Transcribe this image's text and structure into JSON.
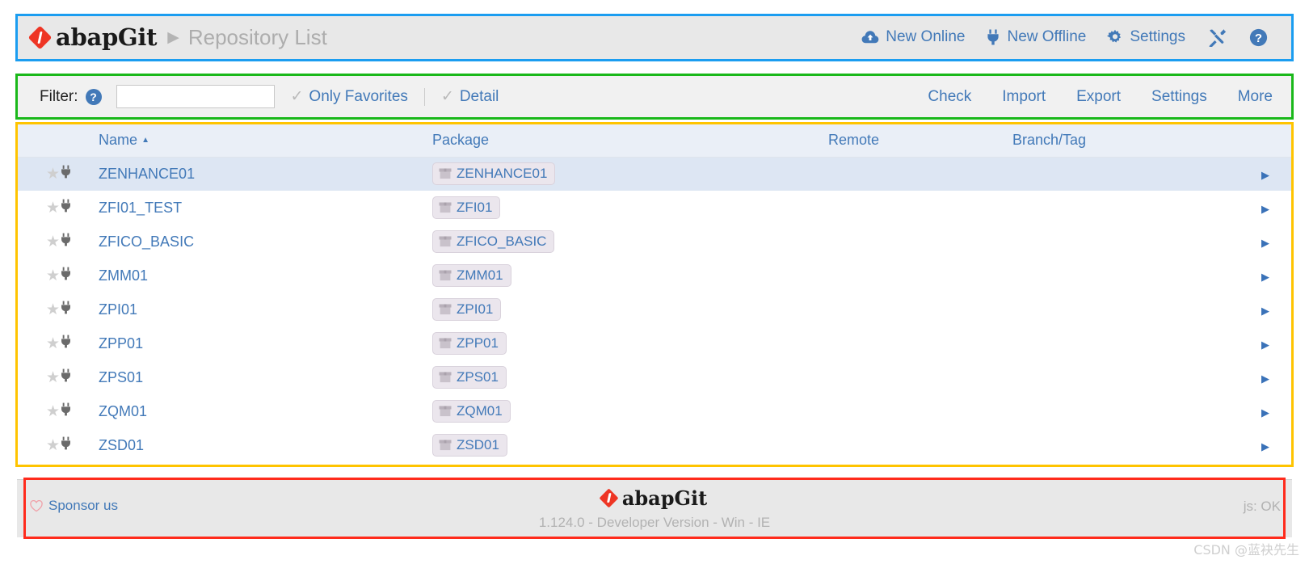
{
  "header": {
    "brand": "abapGit",
    "breadcrumb_separator": "▶",
    "title": "Repository List",
    "actions": [
      {
        "label": "New Online",
        "icon": "cloud-upload-icon"
      },
      {
        "label": "New Offline",
        "icon": "plug-icon"
      },
      {
        "label": "Settings",
        "icon": "gear-icon"
      }
    ],
    "icon_buttons": [
      {
        "name": "tools-icon"
      },
      {
        "name": "help-icon"
      }
    ]
  },
  "filter_bar": {
    "label": "Filter:",
    "help_glyph": "?",
    "input_value": "",
    "input_placeholder": "",
    "toggles": [
      {
        "label": "Only Favorites",
        "checked": false,
        "check_glyph": "✓"
      },
      {
        "label": "Detail",
        "checked": false,
        "check_glyph": "✓"
      }
    ],
    "links": [
      "Check",
      "Import",
      "Export",
      "Settings",
      "More"
    ]
  },
  "table": {
    "columns": [
      "Name",
      "Package",
      "Remote",
      "Branch/Tag"
    ],
    "sorted_column": "Name",
    "sort_caret": "▲",
    "go_caret": "▶",
    "star_glyph": "★",
    "rows": [
      {
        "name": "ZENHANCE01",
        "package": "ZENHANCE01",
        "remote": "",
        "branch": "",
        "favorite": false,
        "type": "offline",
        "highlighted": true
      },
      {
        "name": "ZFI01_TEST",
        "package": "ZFI01",
        "remote": "",
        "branch": "",
        "favorite": false,
        "type": "offline",
        "highlighted": false
      },
      {
        "name": "ZFICO_BASIC",
        "package": "ZFICO_BASIC",
        "remote": "",
        "branch": "",
        "favorite": false,
        "type": "offline",
        "highlighted": false
      },
      {
        "name": "ZMM01",
        "package": "ZMM01",
        "remote": "",
        "branch": "",
        "favorite": false,
        "type": "offline",
        "highlighted": false
      },
      {
        "name": "ZPI01",
        "package": "ZPI01",
        "remote": "",
        "branch": "",
        "favorite": false,
        "type": "offline",
        "highlighted": false
      },
      {
        "name": "ZPP01",
        "package": "ZPP01",
        "remote": "",
        "branch": "",
        "favorite": false,
        "type": "offline",
        "highlighted": false
      },
      {
        "name": "ZPS01",
        "package": "ZPS01",
        "remote": "",
        "branch": "",
        "favorite": false,
        "type": "offline",
        "highlighted": false
      },
      {
        "name": "ZQM01",
        "package": "ZQM01",
        "remote": "",
        "branch": "",
        "favorite": false,
        "type": "offline",
        "highlighted": false
      },
      {
        "name": "ZSD01",
        "package": "ZSD01",
        "remote": "",
        "branch": "",
        "favorite": false,
        "type": "offline",
        "highlighted": false
      }
    ]
  },
  "footer": {
    "sponsor_label": "Sponsor us",
    "sponsor_icon": "heart-icon",
    "brand": "abapGit",
    "version": "1.124.0 - Developer Version - Win - IE",
    "js_status": "js: OK"
  },
  "watermark": "CSDN @蓝袂先生",
  "colors": {
    "link": "#4279b8",
    "brand_red": "#ee3524",
    "header_bg": "#e8e8e8",
    "filter_bg": "#f1f1f1",
    "table_header_bg": "#eaeff7",
    "row_highlight": "#dde6f3",
    "annotation_blue": "#1b9df0",
    "annotation_green": "#1ab81a",
    "annotation_orange": "#ffc400",
    "annotation_red": "#ff2b1c"
  }
}
